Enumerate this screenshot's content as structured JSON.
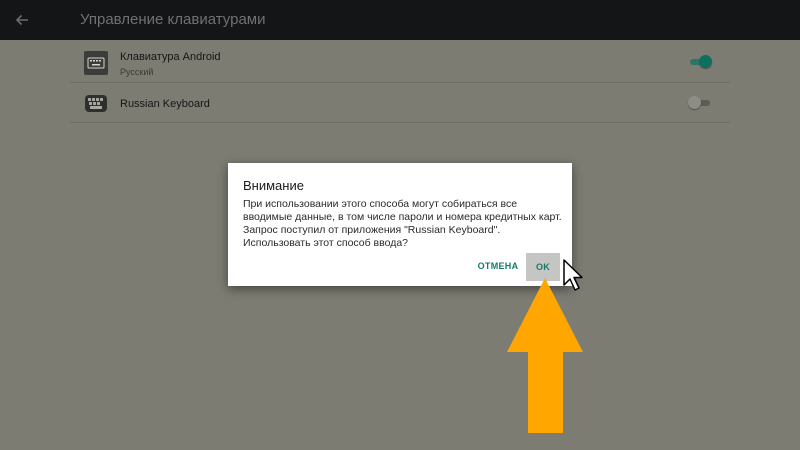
{
  "appbar": {
    "title": "Управление клавиатурами",
    "back_icon": "arrow-left-icon"
  },
  "keyboards": [
    {
      "title": "Клавиатура Android",
      "subtitle": "Русский",
      "icon": "keyboard-icon",
      "enabled": true
    },
    {
      "title": "Russian Keyboard",
      "icon": "keyboard-app-icon",
      "enabled": false
    }
  ],
  "dialog": {
    "title": "Внимание",
    "message": "При использовании этого способа могут собираться все вводимые данные, в том числе пароли и номера кредитных карт. Запрос поступил от приложения \"Russian Keyboard\". Использовать этот способ ввода?",
    "cancel_label": "ОТМЕНА",
    "ok_label": "OK"
  },
  "overlay": {
    "cursor_icon": "mouse-pointer-icon",
    "annotation_icon": "up-arrow-annotation-icon"
  },
  "colors": {
    "scrim": "#7c7c73",
    "appbar": "#131516",
    "accent": "#167a6b",
    "annotation_arrow": "#ffa600"
  }
}
